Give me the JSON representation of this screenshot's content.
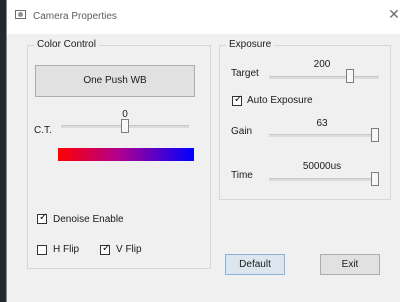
{
  "window": {
    "title": "Camera Properties",
    "close_icon": "close-icon",
    "app_icon": "camera-icon"
  },
  "color_control": {
    "legend": "Color Control",
    "one_push_wb_label": "One Push WB",
    "ct_label": "C.T.",
    "ct_value": "0",
    "ct_fraction": 0.5,
    "denoise_label": "Denoise Enable",
    "denoise_checked": true,
    "hflip_label": "H Flip",
    "hflip_checked": false,
    "vflip_label": "V Flip",
    "vflip_checked": true
  },
  "exposure": {
    "legend": "Exposure",
    "target_label": "Target",
    "target_value": "200",
    "target_fraction": 0.75,
    "auto_exposure_label": "Auto Exposure",
    "auto_exposure_checked": true,
    "gain_label": "Gain",
    "gain_value": "63",
    "gain_fraction": 1.0,
    "time_label": "Time",
    "time_value": "50000us",
    "time_fraction": 1.0
  },
  "buttons": {
    "default_label": "Default",
    "exit_label": "Exit"
  },
  "colors": {
    "ct_gradient_start": "#ff0000",
    "ct_gradient_end": "#0000ff"
  }
}
